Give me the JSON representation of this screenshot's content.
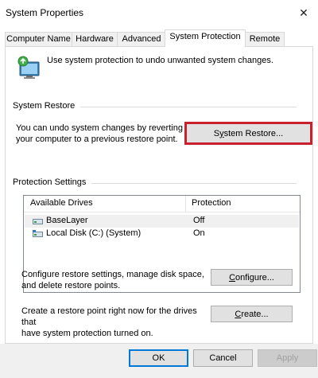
{
  "window": {
    "title": "System Properties",
    "close_glyph": "✕"
  },
  "tabs": [
    {
      "label": "Computer Name"
    },
    {
      "label": "Hardware"
    },
    {
      "label": "Advanced"
    },
    {
      "label": "System Protection",
      "active": true
    },
    {
      "label": "Remote"
    }
  ],
  "intro": {
    "text": "Use system protection to undo unwanted system changes.",
    "icon": "system-protection-icon"
  },
  "system_restore": {
    "heading": "System Restore",
    "description_line1": "You can undo system changes by reverting",
    "description_line2": "your computer to a previous restore point.",
    "button_prefix": "S",
    "button_mnemonic": "y",
    "button_suffix": "stem Restore..."
  },
  "protection_settings": {
    "heading": "Protection Settings",
    "columns": [
      "Available Drives",
      "Protection"
    ],
    "drives": [
      {
        "name": "BaseLayer",
        "protection": "Off",
        "icon": "drive-icon"
      },
      {
        "name": "Local Disk (C:) (System)",
        "protection": "On",
        "icon": "system-drive-icon"
      }
    ]
  },
  "configure": {
    "description_line1": "Configure restore settings, manage disk space,",
    "description_line2": "and delete restore points.",
    "button_mnemonic": "C",
    "button_suffix": "onfigure..."
  },
  "create": {
    "description_line1": "Create a restore point right now for the drives that",
    "description_line2": "have system protection turned on.",
    "button_mnemonic": "C",
    "button_suffix": "reate..."
  },
  "footer": {
    "ok_label": "OK",
    "cancel_label": "Cancel",
    "apply_label": "Apply"
  },
  "colors": {
    "highlight": "#c8202f",
    "default_button_border": "#0078d7"
  }
}
